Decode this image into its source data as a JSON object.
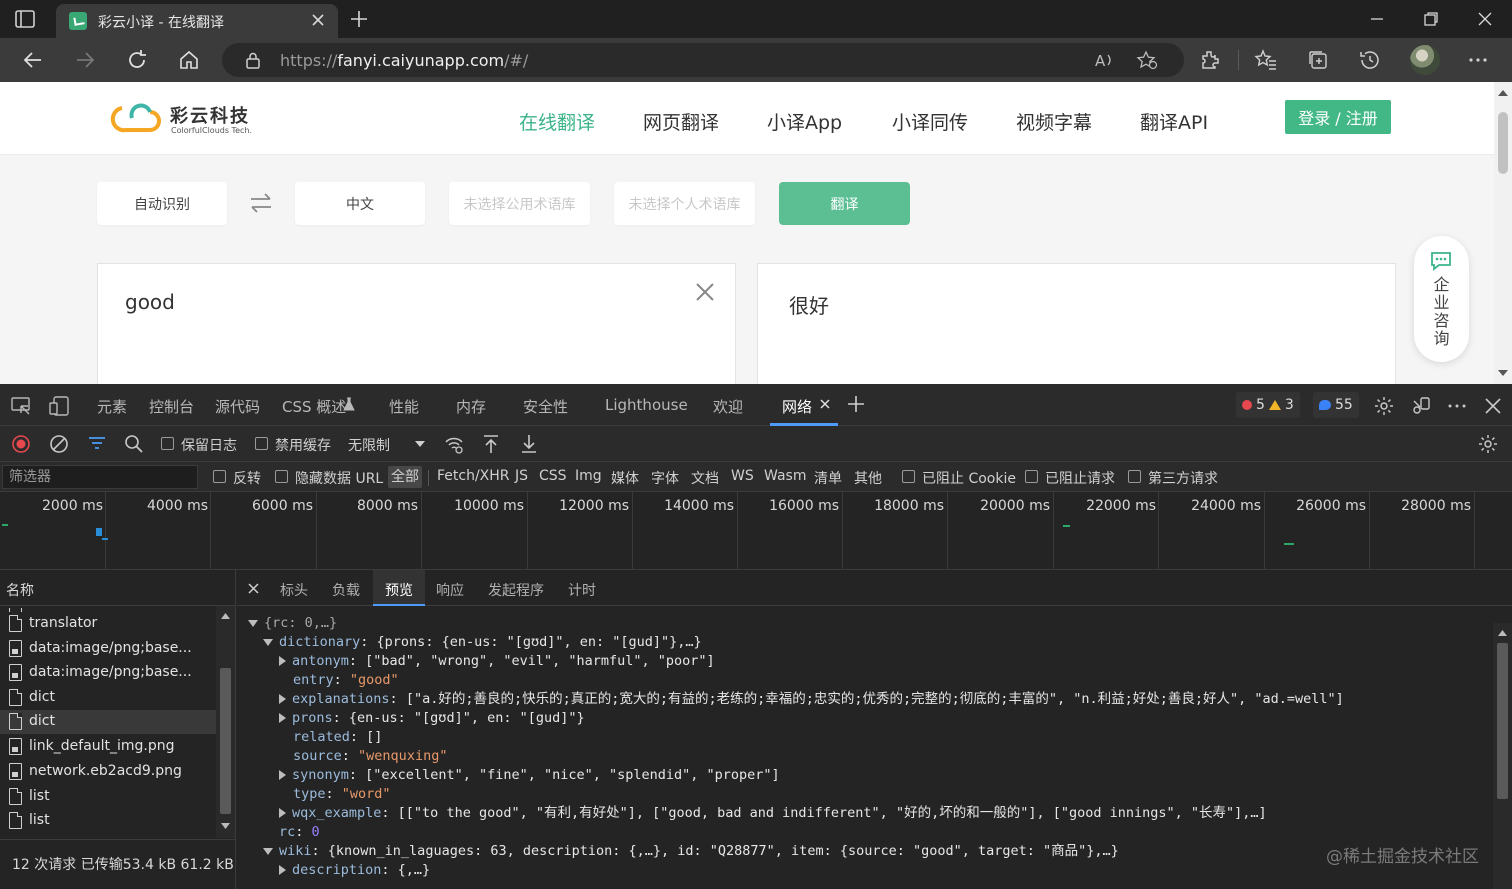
{
  "browser": {
    "tab_title": "彩云小译 - 在线翻译",
    "url_prefix": "https://",
    "url_host": "fanyi.caiyunapp.com",
    "url_path": "/#/"
  },
  "site": {
    "logo_cn": "彩云科技",
    "logo_en": "ColorfulClouds Tech.",
    "nav": [
      "在线翻译",
      "网页翻译",
      "小译App",
      "小译同传",
      "视频字幕",
      "翻译API"
    ],
    "login": "登录 / 注册",
    "source_lang": "自动识别",
    "target_lang": "中文",
    "public_glossary": "未选择公用术语库",
    "personal_glossary": "未选择个人术语库",
    "translate": "翻译",
    "input_text": "good",
    "output_text": "很好",
    "consult": "企业咨询"
  },
  "devtools": {
    "tabs": [
      "元素",
      "控制台",
      "源代码",
      "CSS 概述",
      "性能",
      "内存",
      "安全性",
      "Lighthouse",
      "欢迎",
      "网络"
    ],
    "errors": "5",
    "warnings": "3",
    "messages": "55",
    "toolbar": {
      "preserve_log": "保留日志",
      "disable_cache": "禁用缓存",
      "throttling": "无限制"
    },
    "filter": {
      "placeholder": "筛选器",
      "invert": "反转",
      "hide_data_urls": "隐藏数据 URL",
      "types": [
        "全部",
        "Fetch/XHR",
        "JS",
        "CSS",
        "Img",
        "媒体",
        "字体",
        "文档",
        "WS",
        "Wasm",
        "清单",
        "其他"
      ],
      "blocked_cookies": "已阻止 Cookie",
      "blocked_requests": "已阻止请求",
      "third_party": "第三方请求"
    },
    "timeline_labels": [
      "2000 ms",
      "4000 ms",
      "6000 ms",
      "8000 ms",
      "10000 ms",
      "12000 ms",
      "14000 ms",
      "16000 ms",
      "18000 ms",
      "20000 ms",
      "22000 ms",
      "24000 ms",
      "26000 ms",
      "28000 ms"
    ],
    "name_column": "名称",
    "requests": [
      {
        "name": "translator",
        "icon": "file-icon"
      },
      {
        "name": "data:image/png;base...",
        "icon": "image-icon"
      },
      {
        "name": "data:image/png;base...",
        "icon": "image-icon"
      },
      {
        "name": "dict",
        "icon": "file-icon"
      },
      {
        "name": "dict",
        "icon": "file-icon",
        "selected": true
      },
      {
        "name": "link_default_img.png",
        "icon": "image-icon"
      },
      {
        "name": "network.eb2acd9.png",
        "icon": "image-icon"
      },
      {
        "name": "list",
        "icon": "file-icon"
      },
      {
        "name": "list",
        "icon": "file-icon"
      }
    ],
    "status": "12 次请求  已传输53.4 kB  61.2 kB 纟",
    "detail_tabs": [
      "标头",
      "负载",
      "预览",
      "响应",
      "发起程序",
      "计时"
    ],
    "preview": {
      "root": "{rc: 0,…}",
      "dictionary_key": "dictionary",
      "dictionary_summary": "{prons: {en-us: \"[gʊd]\", en: \"[gud]\"},…}",
      "antonym_key": "antonym",
      "antonym_val": "[\"bad\", \"wrong\", \"evil\", \"harmful\", \"poor\"]",
      "entry_key": "entry",
      "entry_val": "\"good\"",
      "explanations_key": "explanations",
      "explanations_val": "[\"a.好的;善良的;快乐的;真正的;宽大的;有益的;老练的;幸福的;忠实的;优秀的;完整的;彻底的;丰富的\", \"n.利益;好处;善良;好人\", \"ad.=well\"]",
      "prons_key": "prons",
      "prons_val": "{en-us: \"[gʊd]\", en: \"[gud]\"}",
      "related_key": "related",
      "related_val": "[]",
      "source_key": "source",
      "source_val": "\"wenquxing\"",
      "synonym_key": "synonym",
      "synonym_val": "[\"excellent\", \"fine\", \"nice\", \"splendid\", \"proper\"]",
      "type_key": "type",
      "type_val": "\"word\"",
      "wqx_key": "wqx_example",
      "wqx_val": "[[\"to the good\", \"有利,有好处\"], [\"good, bad and indifferent\", \"好的,坏的和一般的\"], [\"good innings\", \"长寿\"],…]",
      "rc_key": "rc",
      "rc_val": "0",
      "wiki_key": "wiki",
      "wiki_val": "{known_in_laguages: 63, description: {,…}, id: \"Q28877\", item: {source: \"good\", target: \"商品\"},…}",
      "description_key": "description",
      "description_val": "{,…}"
    }
  },
  "watermark": "@稀土掘金技术社区",
  "colors": {
    "accent_green": "#42b887",
    "devtools_bg": "#242424",
    "devtools_active_blue": "#4d9df8"
  }
}
